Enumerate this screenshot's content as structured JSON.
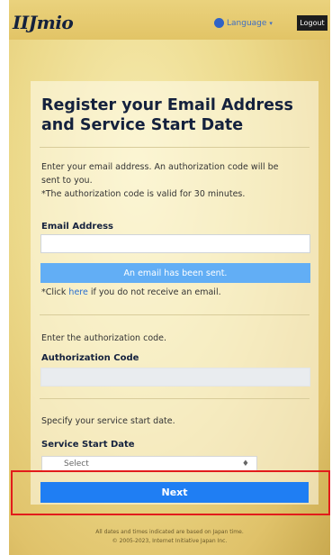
{
  "header": {
    "logo_text": "IIJmio",
    "language_label": "Language",
    "language_caret": "▾",
    "logout_label": "Logout"
  },
  "form": {
    "title": "Register your Email Address and Service Start Date",
    "intro_line1": "Enter your email address. An authorization code will be",
    "intro_line2": "sent to you.",
    "intro_line3": "*The authorization code is valid for 30 minutes.",
    "email_label": "Email Address",
    "email_value": "",
    "sent_message": "An email has been sent.",
    "resend_prefix": "*Click ",
    "resend_link": "here",
    "resend_suffix": " if you do not receive an email.",
    "auth_instruction": "Enter the authorization code.",
    "auth_label": "Authorization Code",
    "auth_value": "",
    "start_instruction": "Specify your service start date.",
    "start_label": "Service Start Date",
    "select_value": "Select",
    "select_caret": "♦",
    "next_label": "Next"
  },
  "footer": {
    "line1": "All dates and times indicated are based on Japan time.",
    "line2": "© 2005-2023, Internet Initiative Japan Inc."
  },
  "colors": {
    "accent_blue": "#1f7ef3",
    "sent_blue": "#62aef5",
    "highlight_red": "#e21b1b",
    "title_navy": "#14213d"
  }
}
